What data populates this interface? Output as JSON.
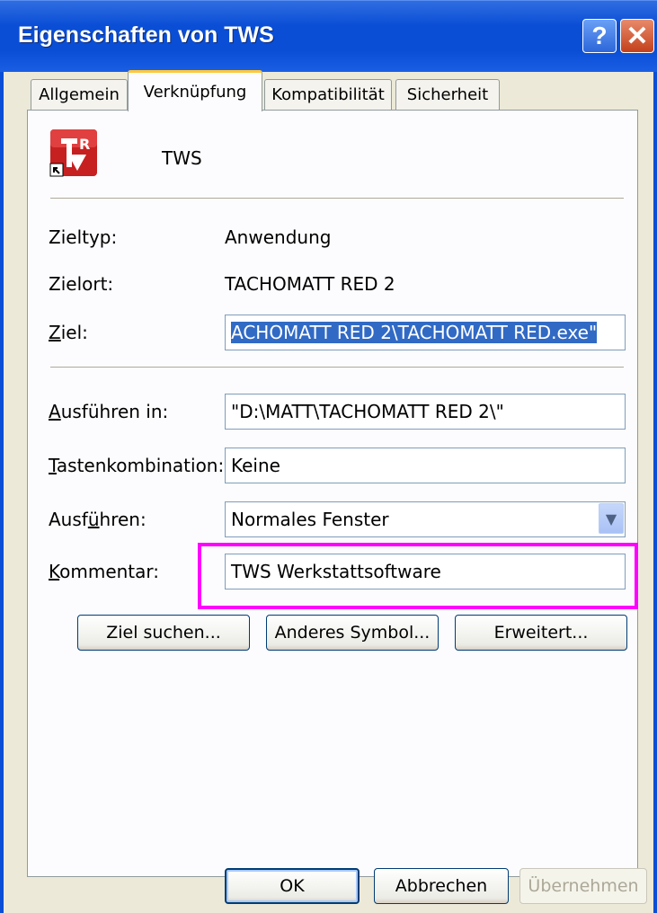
{
  "window": {
    "title": "Eigenschaften von TWS",
    "help_button": "?",
    "close_button": "✕"
  },
  "tabs": [
    "Allgemein",
    "Verknüpfung",
    "Kompatibilität",
    "Sicherheit"
  ],
  "active_tab": "Verknüpfung",
  "shortcut": {
    "name": "TWS",
    "icon": "tachomatt-red-app-icon",
    "icon_colors": {
      "base": "#c62020",
      "letter": "#ffffff"
    }
  },
  "labels": {
    "zieltyp": "Zieltyp:",
    "zielort": "Zielort:",
    "ziel": "Ziel:",
    "ausfuehren_in": "Ausführen in:",
    "tastenkombination": "Tastenkombination:",
    "ausfuehren": "Ausführen:",
    "kommentar": "Kommentar:"
  },
  "values": {
    "zieltyp": "Anwendung",
    "zielort": "TACHOMATT RED 2",
    "ziel": "ACHOMATT RED 2\\TACHOMATT RED.exe\"",
    "ausfuehren_in": "\"D:\\MATT\\TACHOMATT RED 2\\\"",
    "tastenkombination": "Keine",
    "ausfuehren": "Normales Fenster",
    "kommentar": "TWS Werkstattsoftware"
  },
  "action_buttons": {
    "ziel_suchen": "Ziel suchen...",
    "anderes_symbol": "Anderes Symbol...",
    "erweitert": "Erweitert..."
  },
  "footer_buttons": {
    "ok": "OK",
    "abbrechen": "Abbrechen",
    "uebernehmen": "Übernehmen"
  },
  "colors": {
    "titlebar": "#0a4ed6",
    "selection": "#316ac5",
    "highlight_box": "#ff00ff",
    "active_tab_accent": "#ffc83c"
  }
}
